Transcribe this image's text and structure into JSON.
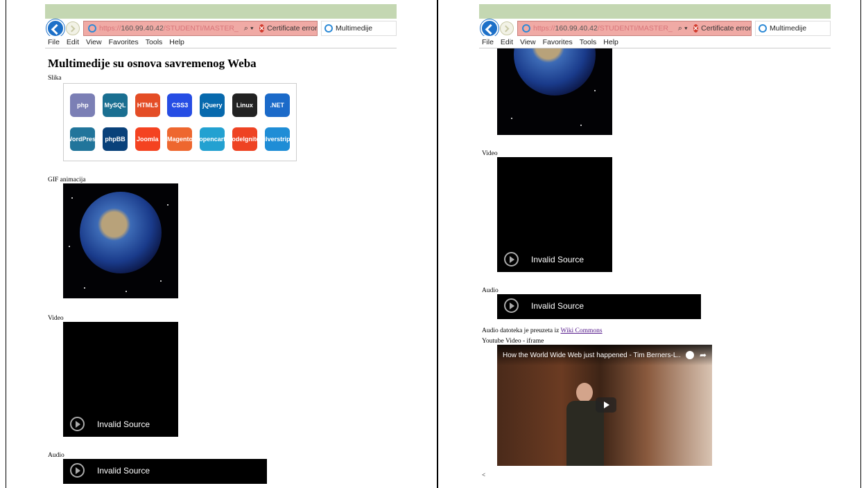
{
  "browser": {
    "url_prefix": "https://",
    "url_host": "160.99.40.42",
    "url_path": "/STUDENTI/MASTER_",
    "cert_error": "Certificate error",
    "tab_title": "Multimedije",
    "menu": [
      "File",
      "Edit",
      "View",
      "Favorites",
      "Tools",
      "Help"
    ]
  },
  "left": {
    "heading": "Multimedije su osnova savremenog Weba",
    "image_label": "Slika",
    "gif_label": "GIF animacija",
    "video_label": "Video",
    "audio_label": "Audio",
    "invalid_source": "Invalid Source",
    "logos_row1": [
      "php",
      "MySQL",
      "HTML5",
      "CSS3",
      "jQuery",
      "Linux",
      ".NET"
    ],
    "logos_row2": [
      "WordPress",
      "phpBB",
      "Joomla",
      "Magento",
      "opencart",
      "CodeIgniter",
      "silverstripe"
    ]
  },
  "right": {
    "video_label": "Video",
    "audio_label": "Audio",
    "invalid_source": "Invalid Source",
    "audio_source_text": "Audio datoteka je preuzeta iz",
    "audio_source_link": "Wiki Commons",
    "youtube_label": "Youtube Video - iframe",
    "youtube_title": "How the World Wide Web just happened - Tim Berners-L...",
    "trailing": "<"
  },
  "colors": {
    "chrome_bg": "#c4d7b2",
    "url_bg": "#f0aaa5",
    "link": "#551a8b",
    "logo_php": "#7b7fb5",
    "logo_mysql": "#1a6f91",
    "logo_html5": "#e44d26",
    "logo_css3": "#264de4",
    "logo_jquery": "#0769ad",
    "logo_linux": "#222222",
    "logo_net": "#1b6ac9",
    "logo_wordpress": "#21759b",
    "logo_phpbb": "#09417a",
    "logo_joomla": "#f44321",
    "logo_magento": "#ee672f",
    "logo_opencart": "#23a1d1",
    "logo_codeigniter": "#ee4323",
    "logo_silverstripe": "#1f8dd6"
  }
}
